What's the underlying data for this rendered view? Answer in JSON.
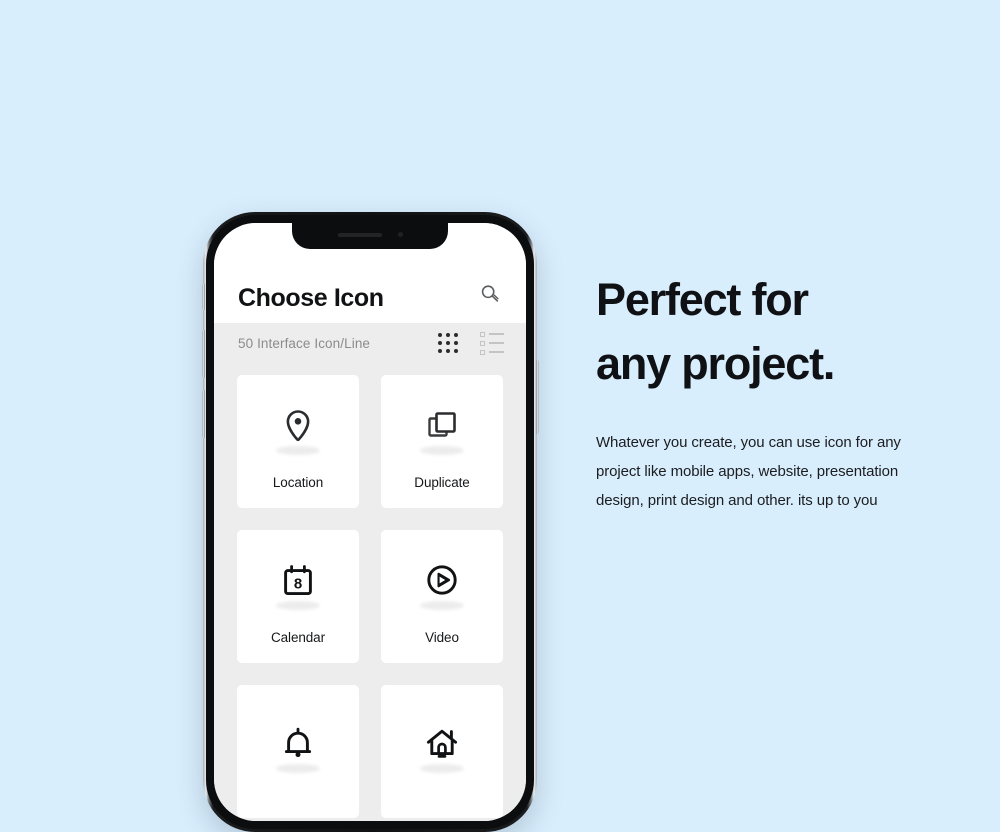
{
  "page": {
    "background_color": "#d9eefd"
  },
  "phone": {
    "device": "smartphone-mockup",
    "notch": {
      "speaker": "earpiece-speaker",
      "camera": "front-camera"
    },
    "side_buttons": [
      "silent-switch",
      "volume-up",
      "volume-down",
      "power"
    ]
  },
  "app": {
    "header": {
      "title": "Choose Icon",
      "search_icon": "search-icon"
    },
    "sub_bar": {
      "label": "50 Interface Icon/Line",
      "grid_view_icon": "grid-view-icon",
      "list_view_icon": "list-view-icon",
      "active_view": "grid"
    },
    "icons": [
      {
        "label": "Location",
        "icon": "location-pin-icon"
      },
      {
        "label": "Duplicate",
        "icon": "duplicate-icon"
      },
      {
        "label": "Calendar",
        "icon": "calendar-icon",
        "day": "8"
      },
      {
        "label": "Video",
        "icon": "video-play-icon"
      },
      {
        "label": "",
        "icon": "bell-icon"
      },
      {
        "label": "",
        "icon": "home-icon"
      }
    ]
  },
  "copy": {
    "headline_line_1": "Perfect for",
    "headline_line_2": "any project.",
    "paragraph": "Whatever you create, you can use icon for any project like mobile apps, website, presentation design, print design and other. its up to you"
  },
  "colors": {
    "background": "#d9eefd",
    "card": "#ffffff",
    "surface": "#ededed",
    "text_primary": "#101114",
    "text_muted": "#8a8c8e",
    "icon_stroke": "#2b2c2e"
  }
}
